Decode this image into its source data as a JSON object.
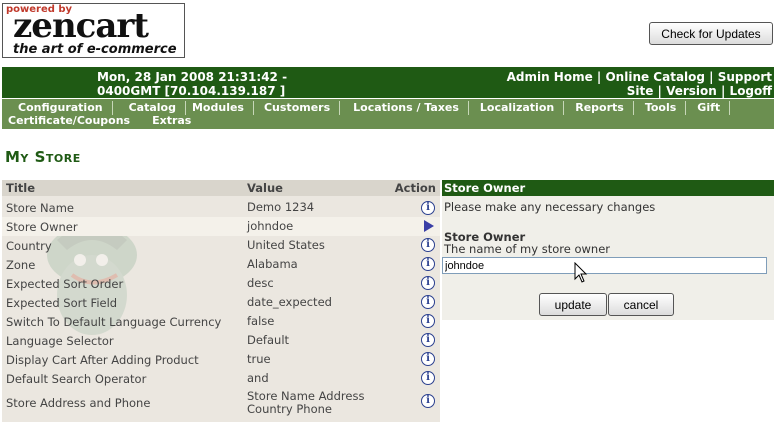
{
  "logo": {
    "powered": "powered by",
    "brand": "zencart",
    "tagline": "the art of e-commerce"
  },
  "check_updates": "Check for Updates",
  "header": {
    "datetime_line1": "Mon, 28 Jan 2008 21:31:42 -",
    "datetime_line2": "0400GMT [70.104.139.187 ]",
    "links_line1": "Admin Home | Online Catalog | Support",
    "links_line2": "Site | Version | Logoff"
  },
  "menu": {
    "row1": [
      "Configuration",
      "Catalog",
      "Modules",
      "Customers",
      "Locations / Taxes",
      "Localization",
      "Reports",
      "Tools",
      "Gift"
    ],
    "row2": [
      "Certificate/Coupons",
      "Extras"
    ]
  },
  "page_title": "My Store",
  "table": {
    "headers": {
      "title": "Title",
      "value": "Value",
      "action": "Action"
    },
    "rows": [
      {
        "title": "Store Name",
        "value": "Demo 1234",
        "action": "info-icon"
      },
      {
        "title": "Store Owner",
        "value": "johndoe",
        "action": "arrow-right-icon"
      },
      {
        "title": "Country",
        "value": "United States",
        "action": "info-icon"
      },
      {
        "title": "Zone",
        "value": "Alabama",
        "action": "info-icon"
      },
      {
        "title": "Expected Sort Order",
        "value": "desc",
        "action": "info-icon"
      },
      {
        "title": "Expected Sort Field",
        "value": "date_expected",
        "action": "info-icon"
      },
      {
        "title": "Switch To Default Language Currency",
        "value": "false",
        "action": "info-icon"
      },
      {
        "title": "Language Selector",
        "value": "Default",
        "action": "info-icon"
      },
      {
        "title": "Display Cart After Adding Product",
        "value": "true",
        "action": "info-icon"
      },
      {
        "title": "Default Search Operator",
        "value": "and",
        "action": "info-icon"
      },
      {
        "title": "Store Address and Phone",
        "value": "Store Name Address\nCountry Phone",
        "action": "info-icon"
      }
    ]
  },
  "edit_panel": {
    "heading": "Store Owner",
    "intro": "Please make any necessary changes",
    "field_label": "Store Owner",
    "field_desc": "The name of my store owner",
    "field_value": "johndoe",
    "update_label": "update",
    "cancel_label": "cancel"
  },
  "colors": {
    "header_green": "#1f5a14",
    "menu_green": "#6b8f50",
    "table_bg": "#ebe7e0"
  }
}
